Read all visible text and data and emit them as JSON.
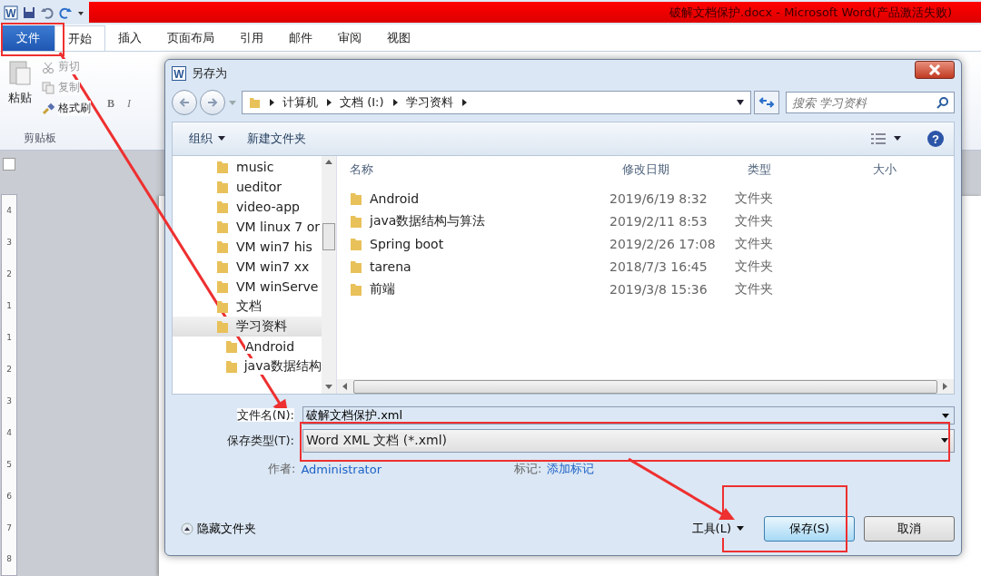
{
  "word": {
    "logo": "W",
    "title": "破解文档保护.docx - Microsoft Word(产品激活失败)",
    "tabs": [
      {
        "label": "文件",
        "kind": "file",
        "selected": false
      },
      {
        "label": "开始",
        "kind": "tab",
        "selected": true
      },
      {
        "label": "插入",
        "kind": "tab",
        "selected": false
      },
      {
        "label": "页面布局",
        "kind": "tab",
        "selected": false
      },
      {
        "label": "引用",
        "kind": "tab",
        "selected": false
      },
      {
        "label": "邮件",
        "kind": "tab",
        "selected": false
      },
      {
        "label": "审阅",
        "kind": "tab",
        "selected": false
      },
      {
        "label": "视图",
        "kind": "tab",
        "selected": false
      }
    ],
    "clipboard": {
      "paste": "粘贴",
      "cut": "剪切",
      "copy": "复制",
      "format_painter": "格式刷",
      "group": "剪贴板"
    },
    "font_buttons": [
      "B",
      "I"
    ],
    "ruler": [
      "4",
      "3",
      "2",
      "1",
      "1",
      "2",
      "3",
      "4",
      "5",
      "6",
      "7",
      "8"
    ]
  },
  "dialog": {
    "logo": "W",
    "title": "另存为",
    "help": "?",
    "breadcrumbs": [
      "计算机",
      "文档 (I:)",
      "学习资料"
    ],
    "search": {
      "placeholder": "搜索 学习资料"
    },
    "organize": "组织",
    "new_folder": "新建文件夹",
    "nav": [
      {
        "label": "music",
        "selected": false
      },
      {
        "label": "ueditor",
        "selected": false
      },
      {
        "label": "video-app",
        "selected": false
      },
      {
        "label": "VM linux 7 or",
        "selected": false
      },
      {
        "label": "VM win7 his",
        "selected": false
      },
      {
        "label": "VM win7 xx",
        "selected": false
      },
      {
        "label": "VM winServe",
        "selected": false
      },
      {
        "label": "文档",
        "selected": false
      },
      {
        "label": "学习资料",
        "selected": true,
        "children": [
          {
            "label": "Android",
            "selected": false
          },
          {
            "label": "java数据结构",
            "selected": false
          }
        ]
      }
    ],
    "columns": [
      "名称",
      "修改日期",
      "类型",
      "大小"
    ],
    "rows": [
      {
        "name": "Android",
        "date": "2019/6/19 8:32",
        "type": "文件夹"
      },
      {
        "name": "java数据结构与算法",
        "date": "2019/2/11 8:53",
        "type": "文件夹"
      },
      {
        "name": "Spring boot",
        "date": "2019/2/26 17:08",
        "type": "文件夹"
      },
      {
        "name": "tarena",
        "date": "2018/7/3 16:45",
        "type": "文件夹"
      },
      {
        "name": "前端",
        "date": "2019/3/8 15:36",
        "type": "文件夹"
      }
    ],
    "file_name": {
      "label": "文件名(N):",
      "value": "破解文档保护.xml"
    },
    "save_type": {
      "label": "保存类型(T):",
      "value": "Word XML 文档 (*.xml)"
    },
    "author": {
      "label": "作者:",
      "value": "Administrator"
    },
    "tags": {
      "label": "标记:",
      "value": "添加标记"
    },
    "hide_folders": "隐藏文件夹",
    "tools": "工具(L)",
    "buttons": [
      "保存(S)",
      "取消"
    ]
  }
}
